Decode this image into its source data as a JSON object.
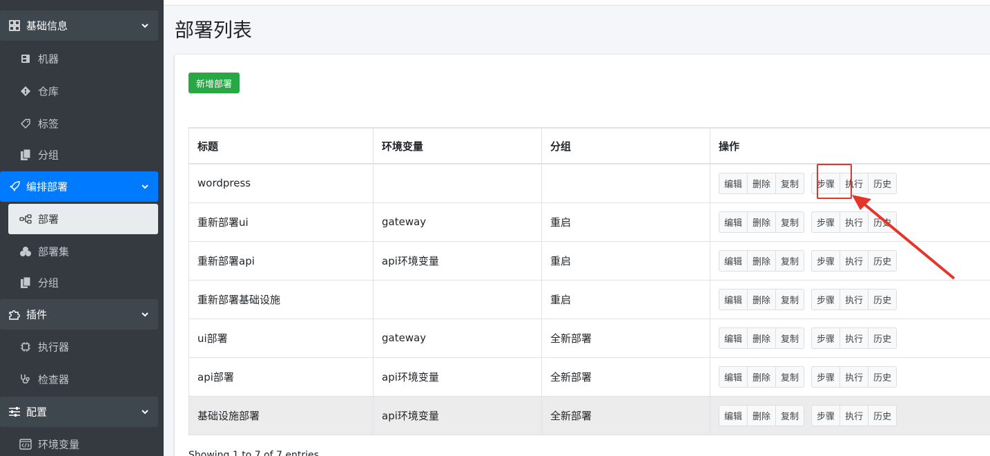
{
  "sidebar": {
    "sections": [
      {
        "label": "基础信息",
        "icon": "grid-icon"
      },
      {
        "label": "编排部署",
        "icon": "rocket-icon"
      },
      {
        "label": "插件",
        "icon": "puzzle-icon"
      },
      {
        "label": "配置",
        "icon": "sliders-icon"
      }
    ],
    "items": [
      {
        "label": "机器",
        "icon": "server-icon"
      },
      {
        "label": "仓库",
        "icon": "git-icon"
      },
      {
        "label": "标签",
        "icon": "tag-icon"
      },
      {
        "label": "分组",
        "icon": "copy-icon"
      },
      {
        "label": "部署",
        "icon": "flow-icon"
      },
      {
        "label": "部署集",
        "icon": "cubes-icon"
      },
      {
        "label": "分组",
        "icon": "copy-icon"
      },
      {
        "label": "执行器",
        "icon": "chip-icon"
      },
      {
        "label": "检查器",
        "icon": "stethoscope-icon"
      },
      {
        "label": "环境变量",
        "icon": "code-file-icon"
      }
    ]
  },
  "page": {
    "title": "部署列表",
    "add_button": "新增部署",
    "footer": "Showing 1 to 7 of 7 entries"
  },
  "table": {
    "headers": [
      "标题",
      "环境变量",
      "分组",
      "操作"
    ],
    "rows": [
      {
        "title": "wordpress",
        "env": "",
        "group": ""
      },
      {
        "title": "重新部署ui",
        "env": "gateway",
        "group": "重启"
      },
      {
        "title": "重新部署api",
        "env": "api环境变量",
        "group": "重启"
      },
      {
        "title": "重新部署基础设施",
        "env": "",
        "group": "重启"
      },
      {
        "title": "ui部署",
        "env": "gateway",
        "group": "全新部署"
      },
      {
        "title": "api部署",
        "env": "api环境变量",
        "group": "全新部署"
      },
      {
        "title": "基础设施部署",
        "env": "api环境变量",
        "group": "全新部署"
      }
    ],
    "actions": [
      "编辑",
      "删除",
      "复制",
      "步骤",
      "执行",
      "历史"
    ]
  },
  "colors": {
    "sidebar_bg": "#343a40",
    "active": "#007bff",
    "success": "#28a745",
    "annotation": "#e5352b"
  }
}
